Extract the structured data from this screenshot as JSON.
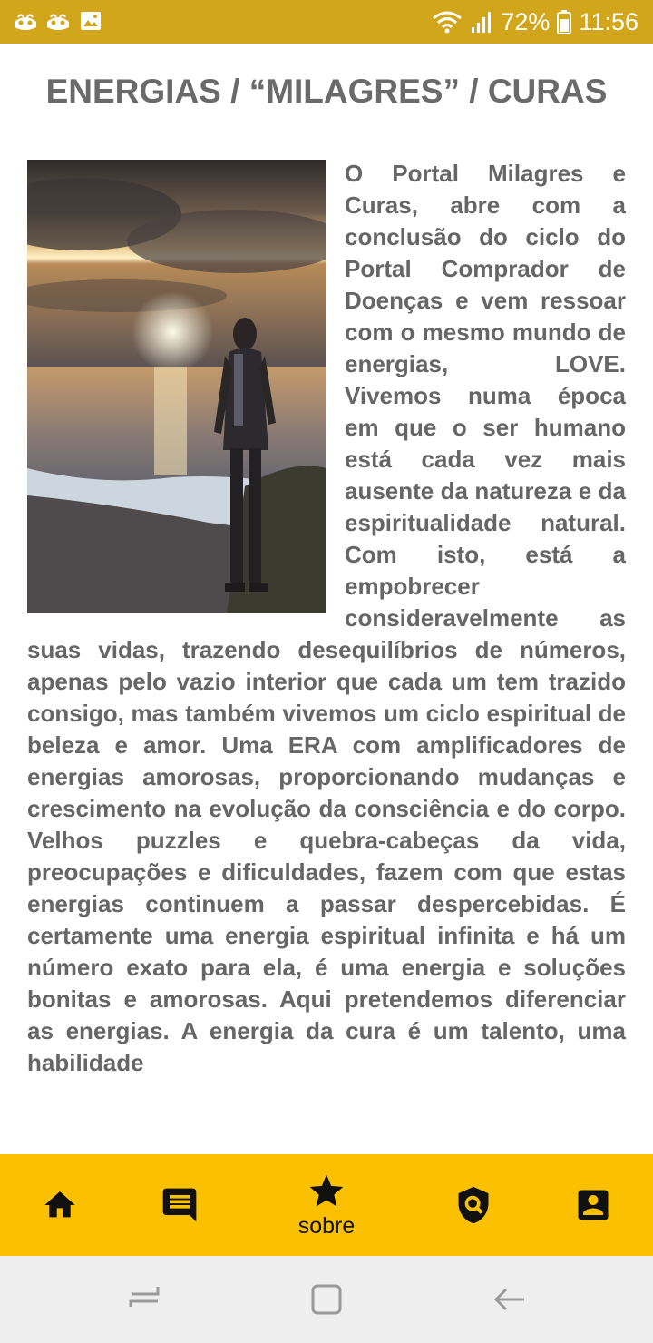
{
  "status_bar": {
    "battery": "72%",
    "time": "11:56",
    "icons": [
      "app-notification-icon",
      "app-notification-icon",
      "image-icon",
      "wifi-icon",
      "signal-icon",
      "battery-icon"
    ]
  },
  "page": {
    "title": "ENERGIAS / “MILAGRES” / CURAS",
    "body": "O Portal Milagres e Curas, abre com a conclusão do ciclo do Portal Comprador de Doenças e vem ressoar com o mesmo mundo de energias, LOVE. Vivemos numa época em que o ser humano está cada vez mais ausente da natureza e da espiritualidade natural. Com isto, está a empobrecer consideravelmente as suas vidas, trazendo desequilíbrios de números, apenas pelo vazio interior que cada um tem trazido consigo, mas também vivemos um ciclo espiritual de beleza e amor. Uma ERA com amplificadores de energias amorosas, proporcionando mudanças e crescimento na evolução da consciência e do corpo. Velhos puzzles e quebra-cabeças da vida, preocupações e dificuldades, fazem com que estas energias continuem a passar despercebidas. É certamente uma energia espiritual infinita e há um número exato para ela, é uma energia e soluções bonitas e amorosas. Aqui pretendemos diferenciar as energias. A energia da cura é um talento, uma habilidade"
  },
  "bottom_nav": {
    "items": [
      {
        "icon": "home-icon"
      },
      {
        "icon": "message-icon"
      },
      {
        "icon": "star-icon",
        "label": "sobre"
      },
      {
        "icon": "shield-search-icon"
      },
      {
        "icon": "account-box-icon"
      }
    ]
  },
  "system_nav": {
    "icons": [
      "recent-apps-icon",
      "home-square-icon",
      "back-arrow-icon"
    ]
  },
  "colors": {
    "status_bar": "#d2a61b",
    "bottom_nav": "#fbc100",
    "text": "#666666",
    "title": "#6a6a6a"
  }
}
